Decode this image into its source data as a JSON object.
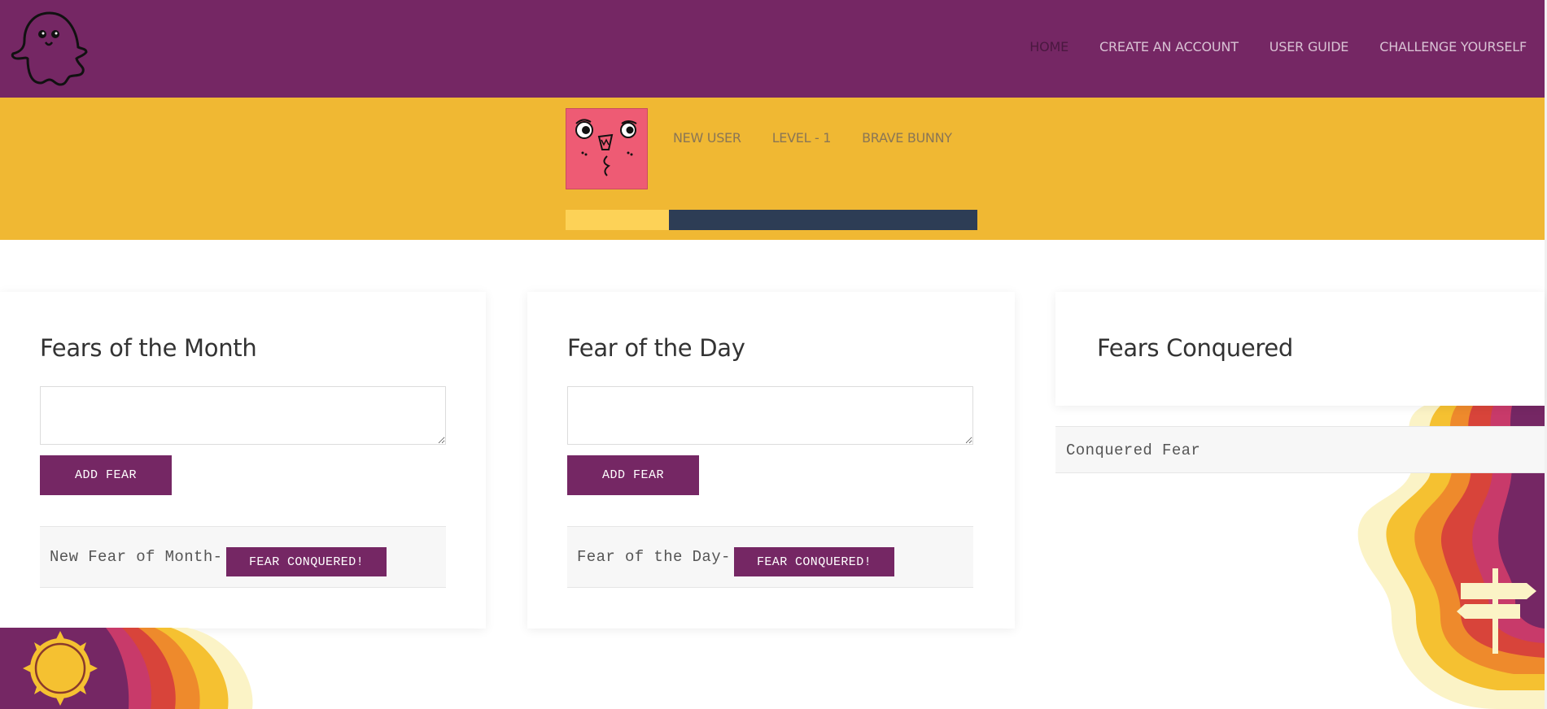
{
  "header": {
    "nav": [
      {
        "label": "HOME",
        "active": true
      },
      {
        "label": "CREATE AN ACCOUNT",
        "active": false
      },
      {
        "label": "USER GUIDE",
        "active": false
      },
      {
        "label": "CHALLENGE YOURSELF",
        "active": false
      }
    ]
  },
  "profile": {
    "username": "NEW USER",
    "level": "LEVEL - 1",
    "rank": "BRAVE BUNNY",
    "progress_fraction": 0.25
  },
  "month_card": {
    "title": "Fears of the Month",
    "input_value": "",
    "add_label": "ADD FEAR",
    "fear_text": "New Fear of Month-",
    "conquer_label": "FEAR CONQUERED!"
  },
  "day_card": {
    "title": "Fear of the Day",
    "input_value": "",
    "add_label": "ADD FEAR",
    "fear_text": "Fear of the Day-",
    "conquer_label": "FEAR CONQUERED!"
  },
  "conquered_card": {
    "title": "Fears Conquered",
    "items": [
      "Conquered Fear"
    ]
  },
  "colors": {
    "brand_purple": "#752764",
    "band_yellow": "#f0b833",
    "progress_fill": "#fdd257",
    "progress_track": "#2d3d55",
    "avatar_pink": "#ee5b74"
  },
  "icons": {
    "logo": "ghost-icon",
    "avatar": "face-doodle-icon",
    "sun": "sun-icon",
    "signpost": "signpost-icon"
  }
}
